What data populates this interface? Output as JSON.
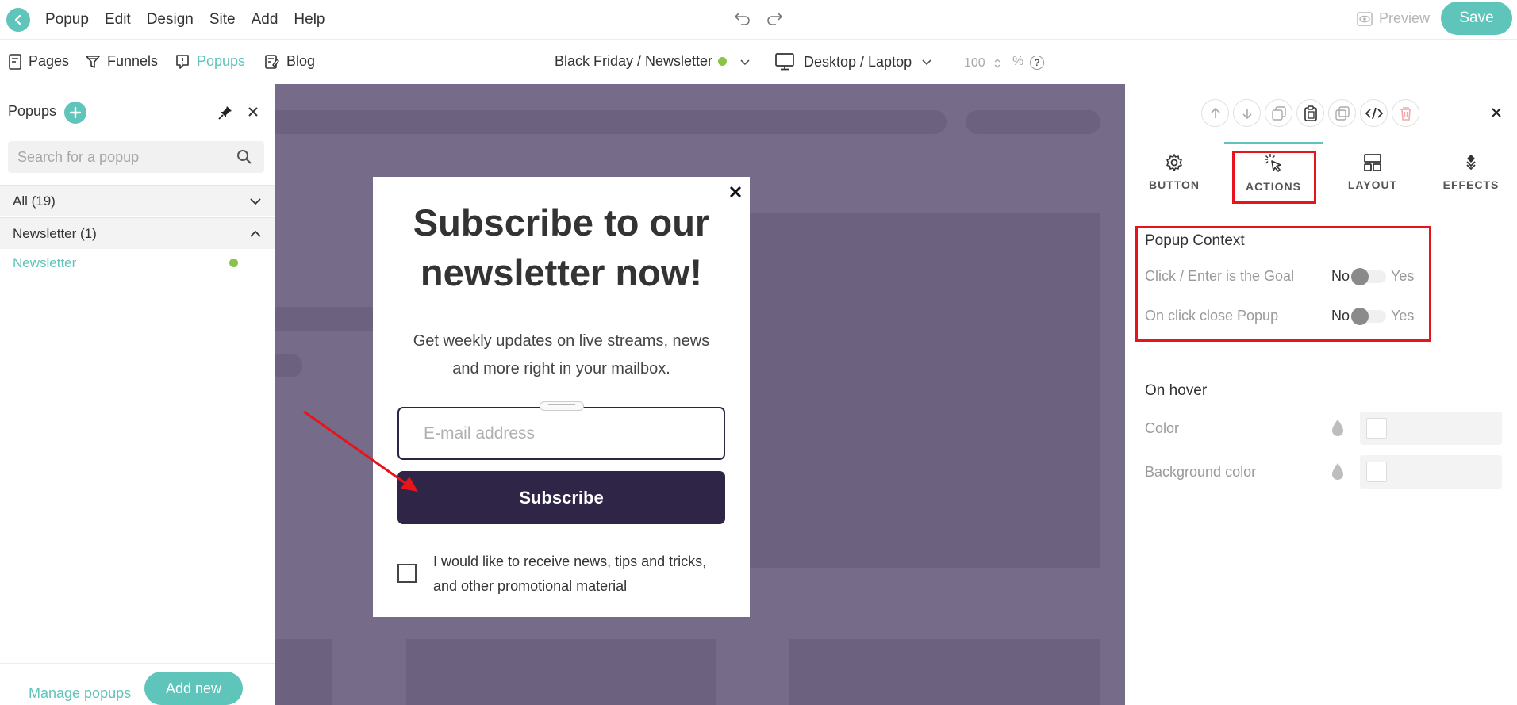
{
  "topbar": {
    "menu": [
      "Popup",
      "Edit",
      "Design",
      "Site",
      "Add",
      "Help"
    ],
    "preview_label": "Preview",
    "save_label": "Save"
  },
  "nav": {
    "items": [
      {
        "label": "Pages",
        "icon": "page-icon"
      },
      {
        "label": "Funnels",
        "icon": "funnel-icon"
      },
      {
        "label": "Popups",
        "icon": "popup-icon",
        "active": true
      },
      {
        "label": "Blog",
        "icon": "blog-icon"
      }
    ],
    "context_label": "Black Friday / Newsletter",
    "device_label": "Desktop / Laptop",
    "zoom_value": "100",
    "zoom_unit": "%",
    "help_label": "?"
  },
  "left_panel": {
    "title": "Popups",
    "search_placeholder": "Search for a popup",
    "groups": [
      {
        "label": "All (19)",
        "expanded": false
      },
      {
        "label": "Newsletter (1)",
        "expanded": true
      }
    ],
    "items": [
      {
        "label": "Newsletter",
        "status": "active"
      }
    ],
    "manage_label": "Manage popups",
    "add_new_label": "Add new"
  },
  "popup": {
    "title": "Subscribe to our newsletter now!",
    "subtitle": "Get weekly updates on live streams, news and more right in your mailbox.",
    "email_placeholder": "E-mail address",
    "button_label": "Subscribe",
    "checkbox_label": "I would like to receive news, tips and tricks, and other promotional material",
    "close_glyph": "×"
  },
  "right_panel": {
    "tabs": [
      {
        "label": "BUTTON",
        "icon": "gear-icon"
      },
      {
        "label": "ACTIONS",
        "icon": "cursor-click-icon",
        "active": true
      },
      {
        "label": "LAYOUT",
        "icon": "layout-icon"
      },
      {
        "label": "EFFECTS",
        "icon": "effects-icon"
      }
    ],
    "popup_context": {
      "title": "Popup Context",
      "rows": [
        {
          "label": "Click / Enter is the Goal",
          "no": "No",
          "yes": "Yes",
          "value": "No"
        },
        {
          "label": "On click close Popup",
          "no": "No",
          "yes": "Yes",
          "value": "No"
        }
      ]
    },
    "on_hover": {
      "title": "On hover",
      "rows": [
        {
          "label": "Color"
        },
        {
          "label": "Background color"
        }
      ]
    }
  },
  "colors": {
    "accent": "#5fc4b9",
    "canvas_bg": "#766b88",
    "button_dark": "#2f2546",
    "highlight": "#e8141b",
    "status_green": "#8bc34a"
  }
}
